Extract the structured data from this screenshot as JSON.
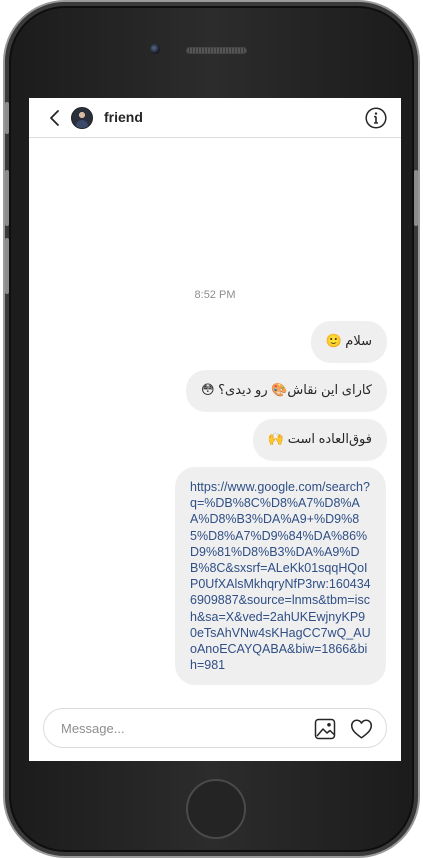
{
  "header": {
    "contact_name": "friend",
    "back_icon": "chevron-left-icon",
    "info_icon": "info-icon"
  },
  "conversation": {
    "timestamp": "8:52 PM",
    "messages": [
      {
        "text": "سلام 🙂"
      },
      {
        "text": "کارای این نقاش🎨 رو دیدی؟ 😳"
      },
      {
        "text": "فوق‌العاده است 🙌"
      },
      {
        "text": "https://www.google.com/search?q=%DB%8C%D8%A7%D8%AA%D8%B3%DA%A9+%D9%85%D8%A7%D9%84%DA%86%D9%81%D8%B3%DA%A9%DB%8C&sxsrf=ALeKk01sqqHQoIP0UfXAlsMkhqryNfP3rw:1604346909887&source=lnms&tbm=isch&sa=X&ved=2ahUKEwjnyKP90eTsAhVNw4sKHagCC7wQ_AUoAnoECAYQABA&biw=1866&bih=981"
      }
    ]
  },
  "composer": {
    "placeholder": "Message...",
    "value": "",
    "image_icon": "image-icon",
    "like_icon": "heart-icon"
  },
  "colors": {
    "bubble_bg": "#efefef",
    "link": "#2f4f86",
    "text": "#262626",
    "muted": "#8e8e8e"
  }
}
